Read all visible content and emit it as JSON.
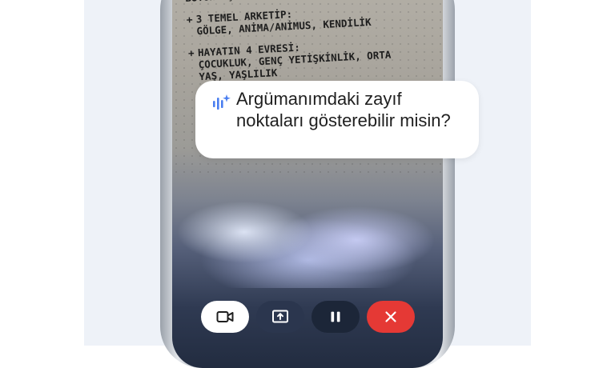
{
  "notes": [
    {
      "lines": [
        "BÜTÜNLEŞTİRME SÜRECİ"
      ],
      "bullet": false
    },
    {
      "lines": [
        "3 TEMEL ARKETİP:",
        "GÖLGE, ANİMA/ANİMUS, KENDİLİK"
      ],
      "bullet": true
    },
    {
      "lines": [
        "HAYATIN 4 EVRESİ:",
        "ÇOCUKLUK, GENÇ YETİŞKİNLİK, ORTA",
        "YAŞ, YAŞLILIK"
      ],
      "bullet": true
    }
  ],
  "bubble": {
    "text": "Argümanımdaki zayıf noktaları gösterebilir misin?",
    "icon": "gemini-spark-icon"
  },
  "controls": {
    "camera_icon": "video-camera-icon",
    "share_icon": "screen-share-icon",
    "pause_icon": "pause-icon",
    "end_icon": "close-icon"
  },
  "colors": {
    "panel_bg": "#eef2f8",
    "end_button": "#e53935",
    "gemini_blue": "#4a7ef0"
  }
}
